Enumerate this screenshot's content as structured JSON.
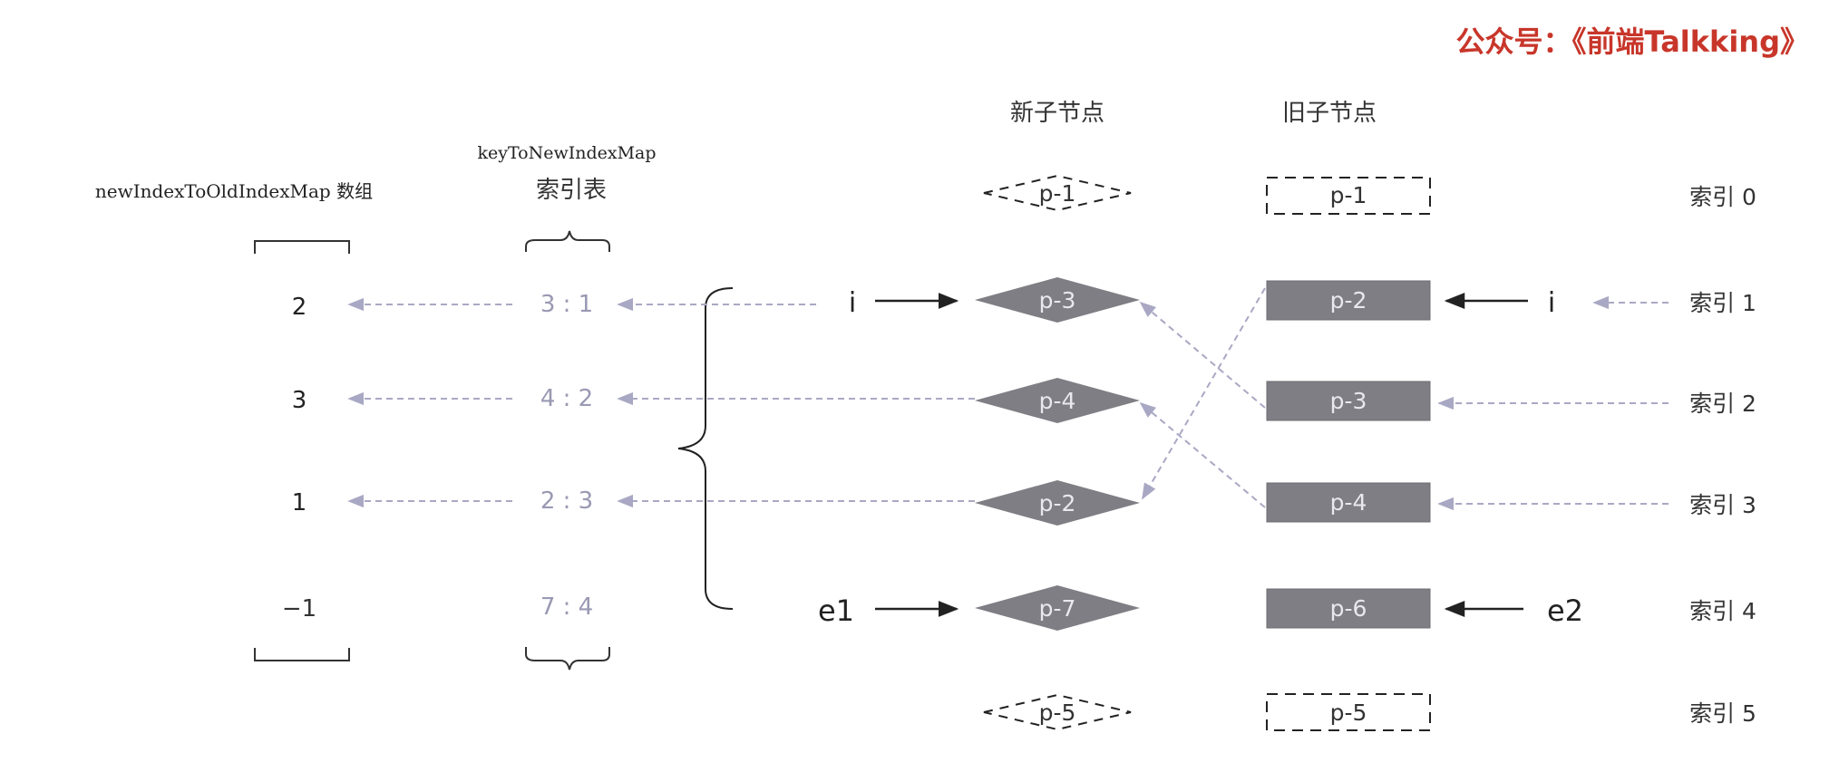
{
  "brand": {
    "text": "公众号：《前端Talkking》",
    "color": "#c8362a"
  },
  "headers": {
    "array_title": "newIndexToOldIndexMap 数组",
    "map_title_en": "keyToNewIndexMap",
    "map_title_cn": "索引表",
    "new_children": "新子节点",
    "old_children": "旧子节点"
  },
  "array_values": [
    "2",
    "3",
    "1",
    "−1"
  ],
  "map_entries": [
    "3 : 1",
    "4 : 2",
    "2 : 3",
    "7 : 4"
  ],
  "new_nodes": [
    "p-1",
    "p-3",
    "p-4",
    "p-2",
    "p-7",
    "p-5"
  ],
  "old_nodes": [
    "p-1",
    "p-2",
    "p-3",
    "p-4",
    "p-6",
    "p-5"
  ],
  "index_labels": [
    "索引 0",
    "索引 1",
    "索引 2",
    "索引 3",
    "索引 4",
    "索引 5"
  ],
  "pointers": {
    "i_left": "i",
    "i_right": "i",
    "e1": "e1",
    "e2": "e2"
  },
  "colors": {
    "node_fill": "#7f7e84",
    "dashed_arrow": "#a9a8c4",
    "text": "#333333",
    "faded_text": "#9a99b3"
  }
}
